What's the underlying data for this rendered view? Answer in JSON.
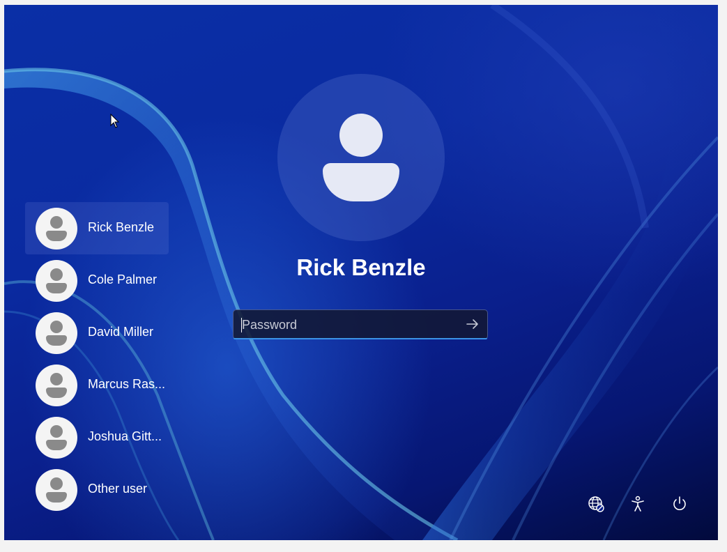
{
  "selected_user": {
    "name": "Rick Benzle"
  },
  "password": {
    "placeholder": "Password",
    "value": ""
  },
  "users": [
    {
      "label": "Rick Benzle",
      "selected": true
    },
    {
      "label": "Cole Palmer"
    },
    {
      "label": "David Miller"
    },
    {
      "label": "Marcus Ras..."
    },
    {
      "label": "Joshua Gitt..."
    },
    {
      "label": "Other user"
    }
  ],
  "system_icons": [
    "network-icon",
    "accessibility-icon",
    "power-icon"
  ],
  "colors": {
    "accent": "#3b93e6",
    "background": "#0a2aa0"
  }
}
